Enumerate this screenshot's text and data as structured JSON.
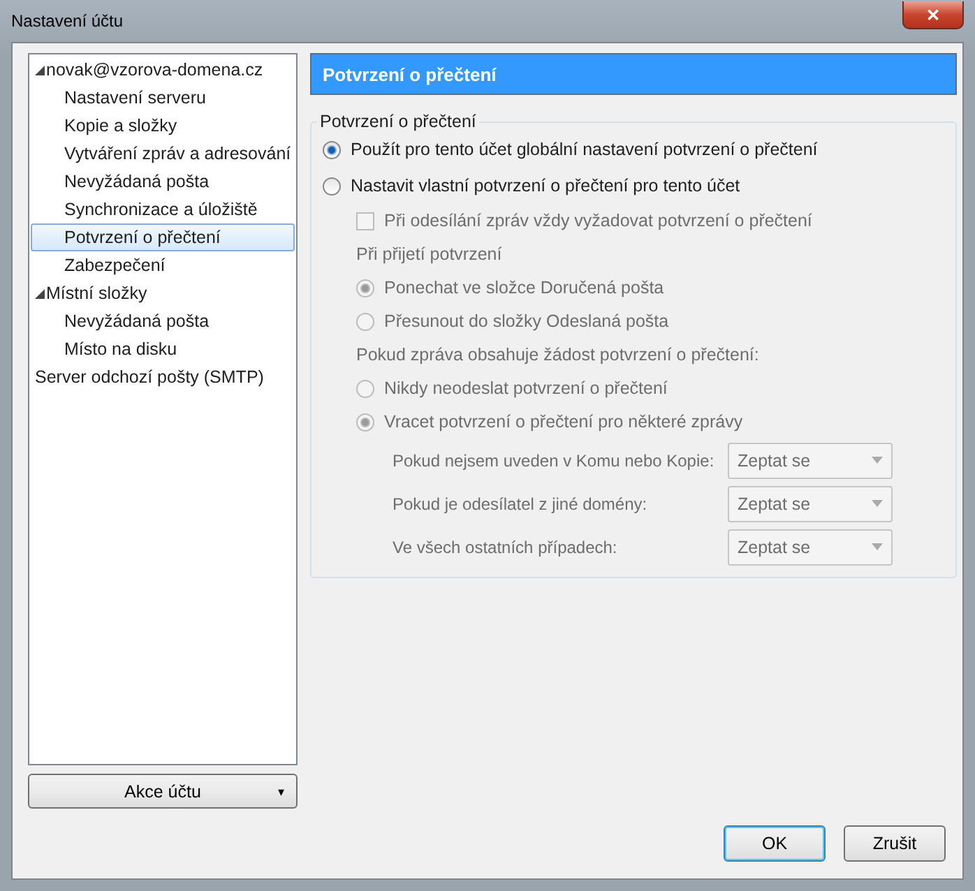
{
  "window": {
    "title": "Nastavení účtu",
    "close": "✕"
  },
  "sidebar": {
    "items": [
      {
        "label": "novak@vzorova-domena.cz",
        "selected": false,
        "expanded": true,
        "children": [
          {
            "label": "Nastavení serveru",
            "selected": false
          },
          {
            "label": "Kopie a složky",
            "selected": false
          },
          {
            "label": "Vytváření zpráv a adresování",
            "selected": false
          },
          {
            "label": "Nevyžádaná pošta",
            "selected": false
          },
          {
            "label": "Synchronizace a úložiště",
            "selected": false
          },
          {
            "label": "Potvrzení o přečtení",
            "selected": true
          },
          {
            "label": "Zabezpečení",
            "selected": false
          }
        ]
      },
      {
        "label": "Místní složky",
        "selected": false,
        "expanded": true,
        "children": [
          {
            "label": "Nevyžádaná pošta",
            "selected": false
          },
          {
            "label": "Místo na disku",
            "selected": false
          }
        ]
      },
      {
        "label": "Server odchozí pošty (SMTP)",
        "selected": false
      }
    ]
  },
  "account_actions": {
    "label": "Akce účtu",
    "caret": "▾"
  },
  "page_title": "Potvrzení o přečtení",
  "group": {
    "title": "Potvrzení o přečtení",
    "items": [
      {
        "kind": "radio",
        "label": "Použít pro tento účet globální nastavení potvrzení o přečtení",
        "selected": true,
        "disabled": false
      },
      {
        "kind": "radio",
        "label": "Nastavit vlastní potvrzení o přečtení pro tento účet",
        "selected": false,
        "disabled": false,
        "children": [
          {
            "kind": "checkbox",
            "label": "Při odesílání zpráv vždy vyžadovat potvrzení o přečtení",
            "checked": false,
            "disabled": true
          },
          {
            "kind": "heading",
            "label": "Při přijetí potvrzení",
            "disabled": true
          },
          {
            "kind": "radio",
            "label": "Ponechat ve složce Doručená pošta",
            "selected": true,
            "disabled": true
          },
          {
            "kind": "radio",
            "label": "Přesunout do složky Odeslaná pošta",
            "selected": false,
            "disabled": true
          },
          {
            "kind": "heading",
            "label": "Pokud zpráva obsahuje žádost potvrzení o přečtení:",
            "disabled": true
          },
          {
            "kind": "radio",
            "label": "Nikdy neodeslat potvrzení o přečtení",
            "selected": false,
            "disabled": true
          },
          {
            "kind": "radio",
            "label": "Vracet potvrzení o přečtení pro některé zprávy",
            "selected": true,
            "disabled": true,
            "children": [
              {
                "kind": "select",
                "label": "Pokud nejsem uveden v Komu nebo Kopie:",
                "value": "Zeptat se",
                "disabled": true
              },
              {
                "kind": "select",
                "label": "Pokud je odesílatel z jiné domény:",
                "value": "Zeptat se",
                "disabled": true
              },
              {
                "kind": "select",
                "label": "Ve všech ostatních případech:",
                "value": "Zeptat se",
                "disabled": true
              }
            ]
          }
        ]
      }
    ]
  },
  "buttons": [
    "OK",
    "Zrušit"
  ]
}
